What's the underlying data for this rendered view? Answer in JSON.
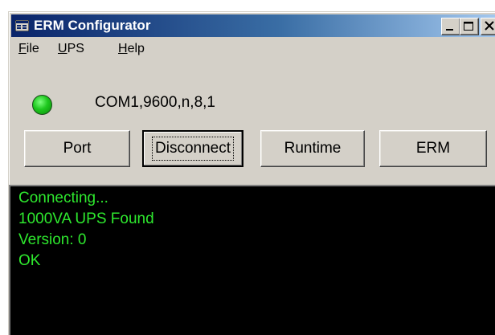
{
  "window": {
    "title": "ERM Configurator",
    "controls": [
      "minimize",
      "maximize",
      "close"
    ]
  },
  "menu": {
    "items": [
      {
        "label": "File",
        "accel": "F",
        "rest": "ile"
      },
      {
        "label": "UPS",
        "accel": "U",
        "rest": "PS"
      },
      {
        "label": "Help",
        "accel": "H",
        "rest": "elp"
      }
    ]
  },
  "status": {
    "led_color": "#1ec81e",
    "port_settings": "COM1,9600,n,8,1"
  },
  "buttons": {
    "port": "Port",
    "disconnect": "Disconnect",
    "runtime": "Runtime",
    "erm": "ERM"
  },
  "console": {
    "text_color": "#2ee82e",
    "lines": [
      "Connecting...",
      "1000VA UPS Found",
      "Version: 0",
      "OK"
    ]
  }
}
